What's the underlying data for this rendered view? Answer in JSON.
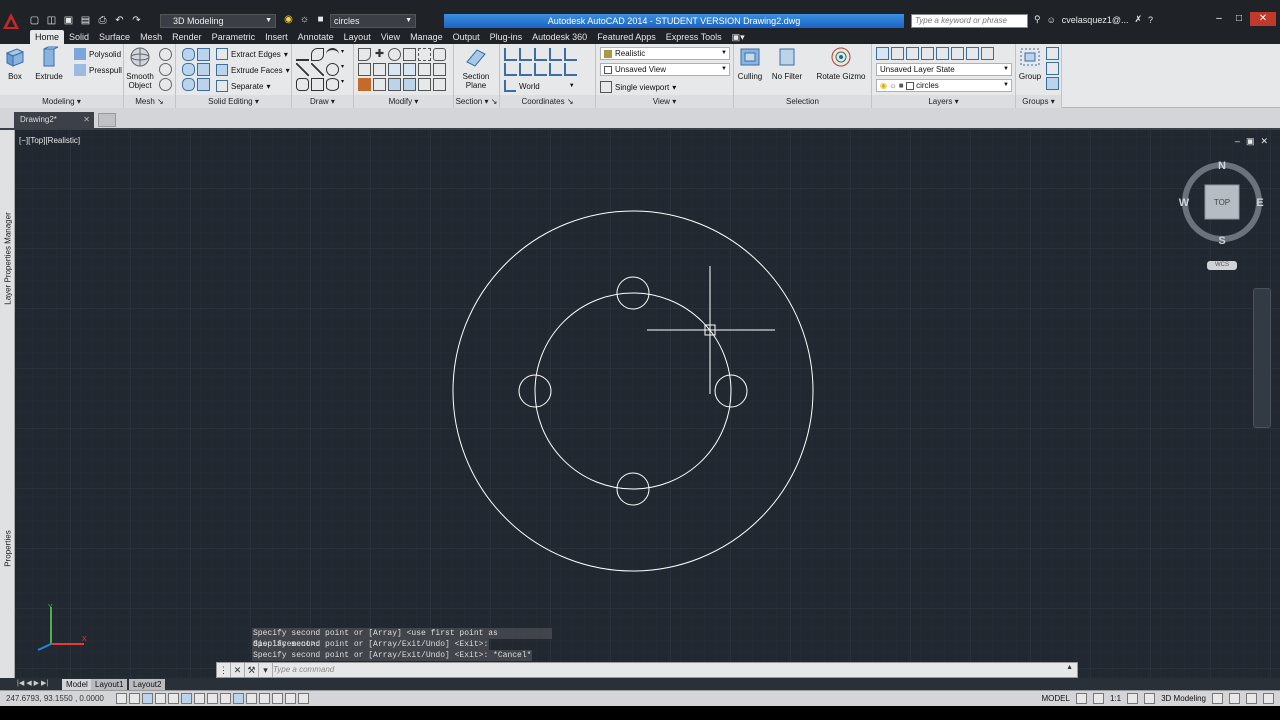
{
  "titlebar": {
    "workspace": "3D Modeling",
    "layer": "circles",
    "title": "Autodesk AutoCAD 2014 - STUDENT VERSION    Drawing2.dwg",
    "search_placeholder": "Type a keyword or phrase",
    "user": "cvelasquez1@..."
  },
  "ribbon_tabs": [
    "Home",
    "Solid",
    "Surface",
    "Mesh",
    "Render",
    "Parametric",
    "Insert",
    "Annotate",
    "Layout",
    "View",
    "Manage",
    "Output",
    "Plug-ins",
    "Autodesk 360",
    "Featured Apps",
    "Express Tools"
  ],
  "ribbon": {
    "modeling": {
      "title": "Modeling",
      "box": "Box",
      "extrude": "Extrude",
      "polysolid": "Polysolid",
      "presspull": "Presspull"
    },
    "mesh": {
      "title": "Mesh",
      "smooth": "Smooth Object"
    },
    "solid_editing": {
      "title": "Solid Editing",
      "extract": "Extract Edges",
      "extrude_faces": "Extrude Faces",
      "separate": "Separate"
    },
    "draw": {
      "title": "Draw"
    },
    "modify": {
      "title": "Modify"
    },
    "section": {
      "title": "Section",
      "section_plane": "Section Plane"
    },
    "coordinates": {
      "title": "Coordinates",
      "world": "World"
    },
    "view": {
      "title": "View",
      "visual_style": "Realistic",
      "named_view": "Unsaved View",
      "viewport": "Single viewport"
    },
    "selection": {
      "title": "Selection",
      "culling": "Culling",
      "no_filter": "No Filter",
      "rotate_gizmo": "Rotate Gizmo"
    },
    "layers": {
      "title": "Layers",
      "layer_state": "Unsaved Layer State",
      "layer": "circles"
    },
    "groups": {
      "title": "Groups",
      "group": "Group"
    }
  },
  "document_tab": "Drawing2*",
  "side_labels": {
    "top": "Layer Properties Manager",
    "bottom": "Properties"
  },
  "viewport_label": "[−][Top][Realistic]",
  "viewcube": {
    "n": "N",
    "s": "S",
    "e": "E",
    "w": "W",
    "face": "TOP",
    "wcs": "WCS"
  },
  "ucs": {
    "x": "X",
    "y": "Y"
  },
  "command_history": [
    "Specify second point or [Array] <use first point as displacement>:",
    "Specify second point or [Array/Exit/Undo] <Exit>:",
    "Specify second point or [Array/Exit/Undo] <Exit>: *Cancel*"
  ],
  "command_placeholder": "Type a command",
  "layout_tabs": [
    "Model",
    "Layout1",
    "Layout2"
  ],
  "status": {
    "coords": "247.6793, 93.1550 , 0.0000",
    "model": "MODEL",
    "scale": "1:1",
    "workspace": "3D Modeling"
  },
  "colors": {
    "canvas": "#212830",
    "accent": "#1c63c4",
    "geometry": "#ffffff"
  }
}
